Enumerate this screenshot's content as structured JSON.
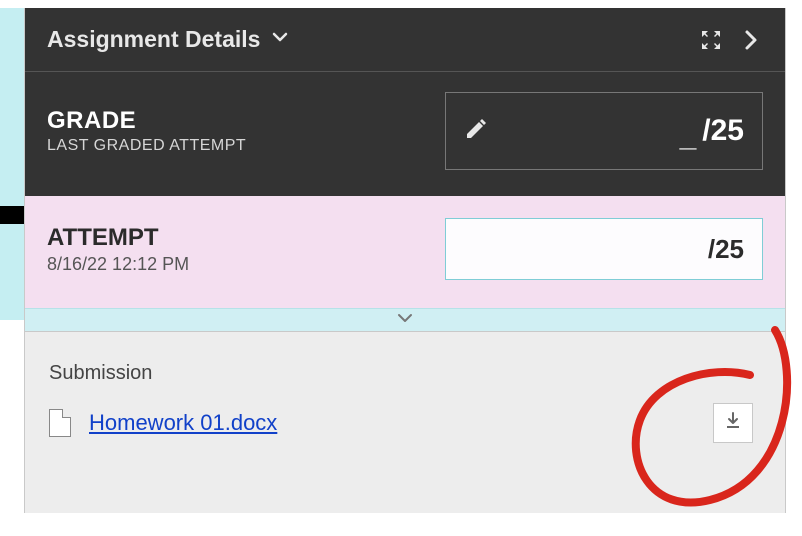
{
  "header": {
    "title": "Assignment Details"
  },
  "grade": {
    "label": "GRADE",
    "sublabel": "LAST GRADED ATTEMPT",
    "value": "_",
    "out_of": "/25"
  },
  "attempt": {
    "label": "ATTEMPT",
    "timestamp": "8/16/22 12:12 PM",
    "value": "",
    "out_of": "/25"
  },
  "submission": {
    "heading": "Submission",
    "file_name": "Homework 01.docx"
  }
}
